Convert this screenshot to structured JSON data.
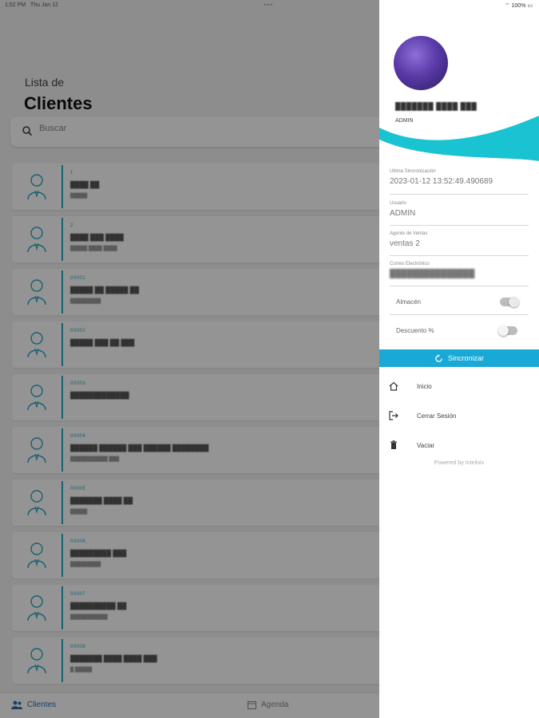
{
  "status_bar": {
    "time": "1:52 PM",
    "date": "Thu Jan 12",
    "dots": "•••",
    "battery": "100%"
  },
  "page": {
    "subtitle": "Lista de",
    "title": "Clientes"
  },
  "search": {
    "placeholder": "Buscar"
  },
  "clients": [
    {
      "code": "1",
      "name": "████ ██",
      "sub": "█████"
    },
    {
      "code": "2",
      "name": "████ ███ ████",
      "sub": "█████ ████ ████"
    },
    {
      "code": "00001",
      "name": "█████ ██ █████ ██",
      "sub": "█████████"
    },
    {
      "code": "00002",
      "name": "█████ ███ ██ ███",
      "sub": ""
    },
    {
      "code": "00003",
      "name": "█████████████",
      "sub": ""
    },
    {
      "code": "00004",
      "name": "██████ ██████ ███ ██████ ████████",
      "sub": "███████████ ███"
    },
    {
      "code": "00005",
      "name": "███████ ████ ██",
      "sub": "█████"
    },
    {
      "code": "00006",
      "name": "█████████ ███",
      "sub": "█████████"
    },
    {
      "code": "00007",
      "name": "██████████ ██",
      "sub": "███████████"
    },
    {
      "code": "00008",
      "name": "███████ ████ ████ ███",
      "sub": "█ █████"
    }
  ],
  "bottom_nav": {
    "clientes": "Clientes",
    "agenda": "Agenda"
  },
  "drawer": {
    "profile_name": "███████ ████ ███",
    "profile_role": "ADMIN",
    "last_sync_label": "Ultima Sincronización",
    "last_sync_value": "2023-01-12 13:52:49.490689",
    "usuario_label": "Usuario",
    "usuario_value": "ADMIN",
    "agente_label": "Agente de Ventas",
    "agente_value": "ventas 2",
    "correo_label": "Correo Electrónico",
    "correo_value": "███████████████",
    "almacen_label": "Almacén",
    "descuento_label": "Descuento %",
    "sync_button": "Sincronizar",
    "menu_inicio": "Inicio",
    "menu_cerrar": "Cerrar Sesión",
    "menu_vaciar": "Vaciar",
    "powered_by": "Powered by Intelisis"
  },
  "colors": {
    "accent": "#1aa9d6",
    "wave": "#19c3d2",
    "list_accent": "#2aa6c4"
  }
}
